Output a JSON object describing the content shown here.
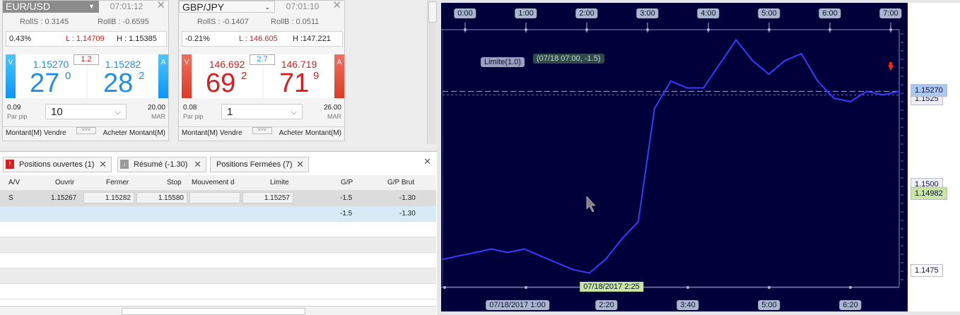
{
  "widgets": [
    {
      "symbol": "EUR/USD",
      "time": "07:01:12",
      "rolls": "RollS : 0.3145",
      "rollb": "RollB : -0.6595",
      "change": "0.43%",
      "low": "L : 1.14709",
      "high": "H : 1.15385",
      "sell_price": "1.15270",
      "sell_big": "27",
      "sell_sup": "0",
      "buy_price": "1.15282",
      "buy_big": "28",
      "buy_sup": "2",
      "spread": "1.2",
      "per_pip_value": "0.09",
      "per_pip_label": "Par pip",
      "amount": "10",
      "margin_value": "20.00",
      "margin_label": "MAR",
      "sell_side": "V",
      "buy_side": "A",
      "foot_left": "Montant(M)  Vendre",
      "foot_right": "Acheter  Montant(M)"
    },
    {
      "symbol": "GBP/JPY",
      "time": "07:01:10",
      "rolls": "RollS : -0.1407",
      "rollb": "RollB : 0.0511",
      "change": "-0.21%",
      "low": "L : 146.605",
      "high": "H :147.221",
      "sell_price": "146.692",
      "sell_big": "69",
      "sell_sup": "2",
      "buy_price": "146.719",
      "buy_big": "71",
      "buy_sup": "9",
      "spread": "2.7",
      "per_pip_value": "0.08",
      "per_pip_label": "Par pip",
      "amount": "1",
      "margin_value": "26.00",
      "margin_label": "MAR",
      "sell_side": "V",
      "buy_side": "A",
      "foot_left": "Montant(M)  Vendre",
      "foot_right": "Acheter  Montant(M)"
    }
  ],
  "tabs": [
    {
      "label": "Positions ouvertes (1)",
      "icon": "alert-icon"
    },
    {
      "label": "Résumé (-1.30)",
      "icon": "summary-icon"
    },
    {
      "label": "Positions Fermées (7)",
      "icon": ""
    }
  ],
  "columns": [
    "A/V",
    "Ouvrir",
    "Fermer",
    "Stop",
    "Mouvement d",
    "Limite",
    "G/P",
    "G/P Brut"
  ],
  "rows": [
    {
      "side": "S",
      "open": "1.15267",
      "close": "1.15282",
      "stop": "1.15580",
      "move": "",
      "limit": "1.15257",
      "pl": "-1.5",
      "gross": "-1.30"
    }
  ],
  "totals": {
    "pl": "-1.5",
    "gross": "-1.30"
  },
  "chart": {
    "time_labels_top": [
      "0:00",
      "1:00",
      "2:00",
      "3:00",
      "4:00",
      "5:00",
      "6:00",
      "7:00"
    ],
    "time_labels_bottom": [
      "07/18/2017   1:00",
      "2:20",
      "3:40",
      "5:00",
      "6:20"
    ],
    "crosshair_time": "07/18/2017 2:25",
    "limit_tag": "Limite(1.0)",
    "tooltip": "(07/18 07:00, -1.5)",
    "price_labels": [
      "1.15270",
      "1.1525",
      "1.1500",
      "1.14982",
      "1.1475"
    ],
    "current_price": "1.15270",
    "crosshair_price": "1.14982",
    "colors": {
      "background": "#00003a",
      "line": "#3a3aff",
      "crosshair_price": "#c8e6a0",
      "current_price": "#a8c8f0"
    }
  },
  "chart_data": {
    "type": "line",
    "x": [
      "0:00",
      "0:15",
      "0:30",
      "0:45",
      "1:00",
      "1:15",
      "1:30",
      "1:45",
      "2:00",
      "2:15",
      "2:30",
      "2:45",
      "3:00",
      "3:15",
      "3:30",
      "3:45",
      "4:00",
      "4:15",
      "4:30",
      "4:45",
      "5:00",
      "5:15",
      "5:30",
      "5:45",
      "6:00",
      "6:15",
      "6:30",
      "6:45",
      "7:00"
    ],
    "values": [
      1.1478,
      1.1479,
      1.148,
      1.1481,
      1.148,
      1.1481,
      1.1479,
      1.1477,
      1.1475,
      1.1474,
      1.1478,
      1.1484,
      1.1489,
      1.1522,
      1.153,
      1.1528,
      1.1528,
      1.1535,
      1.1542,
      1.1536,
      1.1532,
      1.1536,
      1.1538,
      1.153,
      1.1525,
      1.1524,
      1.1527,
      1.1526,
      1.1527
    ],
    "ylim": [
      1.147,
      1.1545
    ],
    "xlabel": "",
    "ylabel": ""
  }
}
